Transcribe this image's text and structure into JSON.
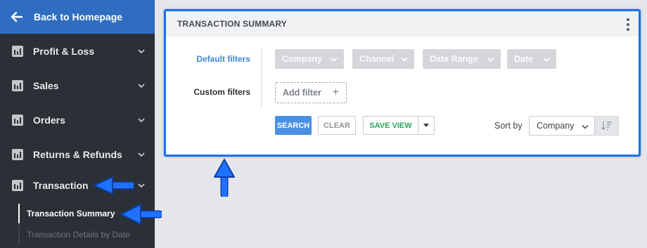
{
  "sidebar": {
    "back_label": "Back to Homepage",
    "items": [
      {
        "label": "Profit & Loss"
      },
      {
        "label": "Sales"
      },
      {
        "label": "Orders"
      },
      {
        "label": "Returns & Refunds"
      },
      {
        "label": "Transaction"
      }
    ],
    "sub_items": [
      {
        "label": "Transaction Summary",
        "active": true
      },
      {
        "label": "Transaction Details by Date",
        "active": false
      }
    ]
  },
  "panel": {
    "title": "TRANSACTION SUMMARY",
    "default_filters_label": "Default filters",
    "custom_filters_label": "Custom filters",
    "filter_chips": [
      "Company",
      "Channel",
      "Date Range",
      "Date"
    ],
    "add_filter_label": "Add filter",
    "buttons": {
      "search": "SEARCH",
      "clear": "CLEAR",
      "save_view": "SAVE VIEW"
    },
    "sort_by_label": "Sort by",
    "sort_value": "Company"
  },
  "colors": {
    "accent": "#1e6fe8",
    "sidebar_bg": "#2b3036",
    "back_link_bg": "#2f6dc0",
    "search_button": "#4a90e2",
    "save_view_text": "#2aa35a",
    "default_filters_label": "#3d86d8"
  },
  "icons": {
    "back": "arrow-left-icon",
    "nav": "bar-chart-icon",
    "expand": "chevron-down-icon",
    "more": "kebab-menu-icon",
    "add": "plus-icon",
    "sort_direction": "sort-descending-icon",
    "callout": "blue-arrow-pointer"
  }
}
